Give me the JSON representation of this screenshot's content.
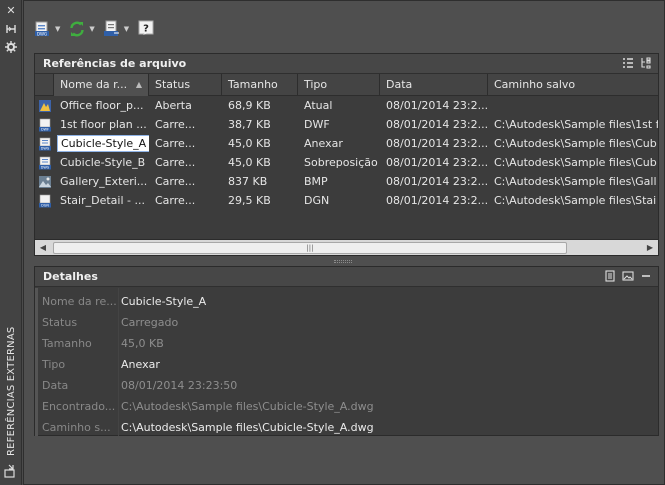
{
  "palette": {
    "title": "REFERÊNCIAS EXTERNAS"
  },
  "icons": {
    "close": "close-icon",
    "autohide": "autohide-icon",
    "properties": "properties-icon",
    "palette_menu": "palette-menu-icon"
  },
  "toolbar": {
    "attach": "attach-dwg-icon",
    "refresh": "refresh-icon",
    "change_path": "change-path-icon",
    "help": "help-icon"
  },
  "file_refs": {
    "title": "Referências de arquivo",
    "columns": [
      "Nome da r...",
      "Status",
      "Tamanho",
      "Tipo",
      "Data",
      "Caminho salvo"
    ],
    "rows": [
      {
        "icon": "dwg-current",
        "name": "Office floor_p...",
        "status": "Aberta",
        "size": "68,9 KB",
        "type": "Atual",
        "date": "08/01/2014 23:2...",
        "path": ""
      },
      {
        "icon": "dwf",
        "name": "1st floor plan ...",
        "status": "Carre...",
        "size": "38,7 KB",
        "type": "DWF",
        "date": "08/01/2014 23:2...",
        "path": "C:\\Autodesk\\Sample files\\1st f"
      },
      {
        "icon": "dwg",
        "name": "Cubicle-Style_A",
        "status": "Carre...",
        "size": "45,0 KB",
        "type": "Anexar",
        "date": "08/01/2014 23:2...",
        "path": "C:\\Autodesk\\Sample files\\Cub",
        "selected": true
      },
      {
        "icon": "dwg",
        "name": "Cubicle-Style_B",
        "status": "Carre...",
        "size": "45,0 KB",
        "type": "Sobreposição",
        "date": "08/01/2014 23:2...",
        "path": "C:\\Autodesk\\Sample files\\Cub"
      },
      {
        "icon": "bmp",
        "name": "Gallery_Exteri...",
        "status": "Carre...",
        "size": "837 KB",
        "type": "BMP",
        "date": "08/01/2014 23:2...",
        "path": "C:\\Autodesk\\Sample files\\Gall"
      },
      {
        "icon": "dgn",
        "name": "Stair_Detail - ...",
        "status": "Carre...",
        "size": "29,5 KB",
        "type": "DGN",
        "date": "08/01/2014 23:2...",
        "path": "C:\\Autodesk\\Sample files\\Stai"
      }
    ]
  },
  "details": {
    "title": "Detalhes",
    "rows": [
      {
        "label": "Nome da re...",
        "value": "Cubicle-Style_A",
        "bright": true
      },
      {
        "label": "Status",
        "value": "Carregado",
        "bright": false
      },
      {
        "label": "Tamanho",
        "value": "45,0 KB",
        "bright": false
      },
      {
        "label": "Tipo",
        "value": "Anexar",
        "bright": true
      },
      {
        "label": "Data",
        "value": "08/01/2014 23:23:50",
        "bright": false
      },
      {
        "label": "Encontrado...",
        "value": "C:\\Autodesk\\Sample files\\Cubicle-Style_A.dwg",
        "bright": false
      },
      {
        "label": "Caminho s...",
        "value": "C:\\Autodesk\\Sample files\\Cubicle-Style_A.dwg",
        "bright": true
      }
    ]
  },
  "colors": {
    "accent": "#8fb3e6",
    "refresh_green": "#3fae3f",
    "panel_bg": "#3c3c3c"
  }
}
